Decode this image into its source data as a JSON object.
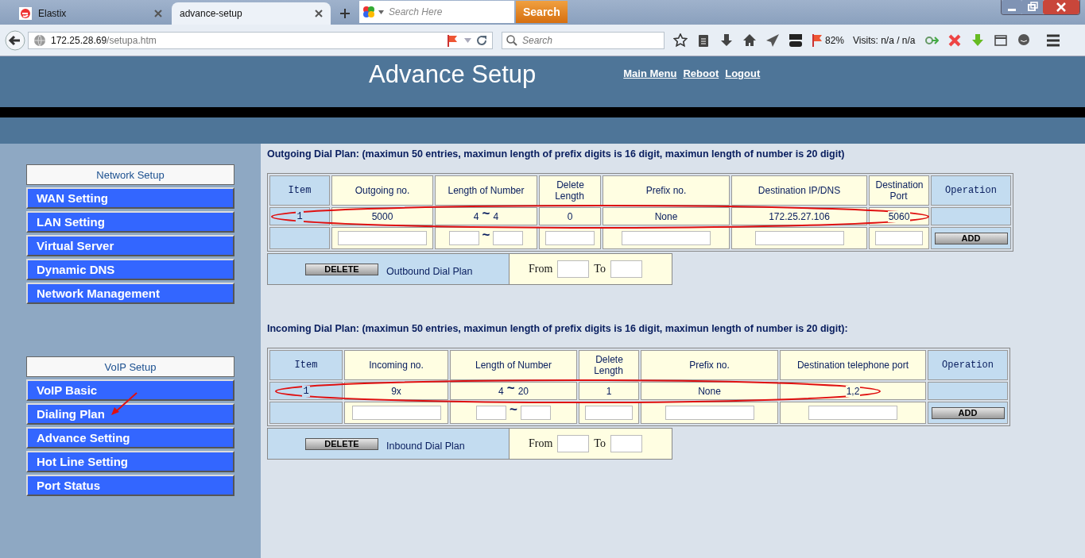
{
  "browser": {
    "tabs": [
      {
        "title": "Elastix",
        "selected": false
      },
      {
        "title": "advance-setup",
        "selected": true
      }
    ],
    "web_search": {
      "placeholder": "Search Here",
      "button": "Search"
    },
    "url": {
      "host": "172.25.28.69",
      "path": "/setupa.htm"
    },
    "search": {
      "placeholder": "Search"
    },
    "zoom": "82%",
    "visits": "Visits: n/a / n/a"
  },
  "header": {
    "title": "Advance Setup",
    "links": [
      "Main Menu",
      "Reboot",
      "Logout"
    ]
  },
  "sidebar": {
    "groups": [
      {
        "heading": "Network Setup",
        "items": [
          "WAN Setting",
          "LAN Setting",
          "Virtual Server",
          "Dynamic DNS",
          "Network Management"
        ]
      },
      {
        "heading": "VoIP Setup",
        "items": [
          "VoIP Basic",
          "Dialing Plan",
          "Advance Setting",
          "Hot Line Setting",
          "Port Status"
        ]
      }
    ]
  },
  "plans": [
    {
      "title": "Outgoing Dial Plan: (maximun 50 entries, maximun length of prefix digits is 16 digit, maximun length of number is 20 digit)",
      "columns": [
        {
          "label": "Item",
          "kind": "item"
        },
        {
          "label": "Outgoing no.",
          "kind": "text"
        },
        {
          "label": "Length of Number",
          "kind": "range"
        },
        {
          "label": "Delete Length",
          "kind": "text"
        },
        {
          "label": "Prefix no.",
          "kind": "text"
        },
        {
          "label": "Destination IP/DNS",
          "kind": "text"
        },
        {
          "label": "Destination Port",
          "kind": "text"
        },
        {
          "label": "Operation",
          "kind": "op"
        }
      ],
      "rows": [
        {
          "cells": [
            "1",
            "5000",
            [
              "4",
              "4"
            ],
            "0",
            "None",
            "172.25.27.106",
            "5060",
            ""
          ]
        }
      ],
      "separator": "~",
      "add_button": "ADD",
      "delete_button": "DELETE",
      "delete_label": "Outbound Dial Plan",
      "from_label": "From",
      "to_label": "To"
    },
    {
      "title": "Incoming Dial Plan: (maximun 50 entries, maximun length of prefix digits is 16 digit, maximun length of number is 20 digit):",
      "columns": [
        {
          "label": "Item",
          "kind": "item"
        },
        {
          "label": "Incoming no.",
          "kind": "text"
        },
        {
          "label": "Length of Number",
          "kind": "range"
        },
        {
          "label": "Delete Length",
          "kind": "text"
        },
        {
          "label": "Prefix no.",
          "kind": "text"
        },
        {
          "label": "Destination telephone port",
          "kind": "text"
        },
        {
          "label": "Operation",
          "kind": "op"
        }
      ],
      "rows": [
        {
          "cells": [
            "1",
            "9x",
            [
              "4",
              "20"
            ],
            "1",
            "None",
            "1,2",
            ""
          ]
        }
      ],
      "separator": "~",
      "add_button": "ADD",
      "delete_button": "DELETE",
      "delete_label": "Inbound Dial Plan",
      "from_label": "From",
      "to_label": "To"
    }
  ]
}
